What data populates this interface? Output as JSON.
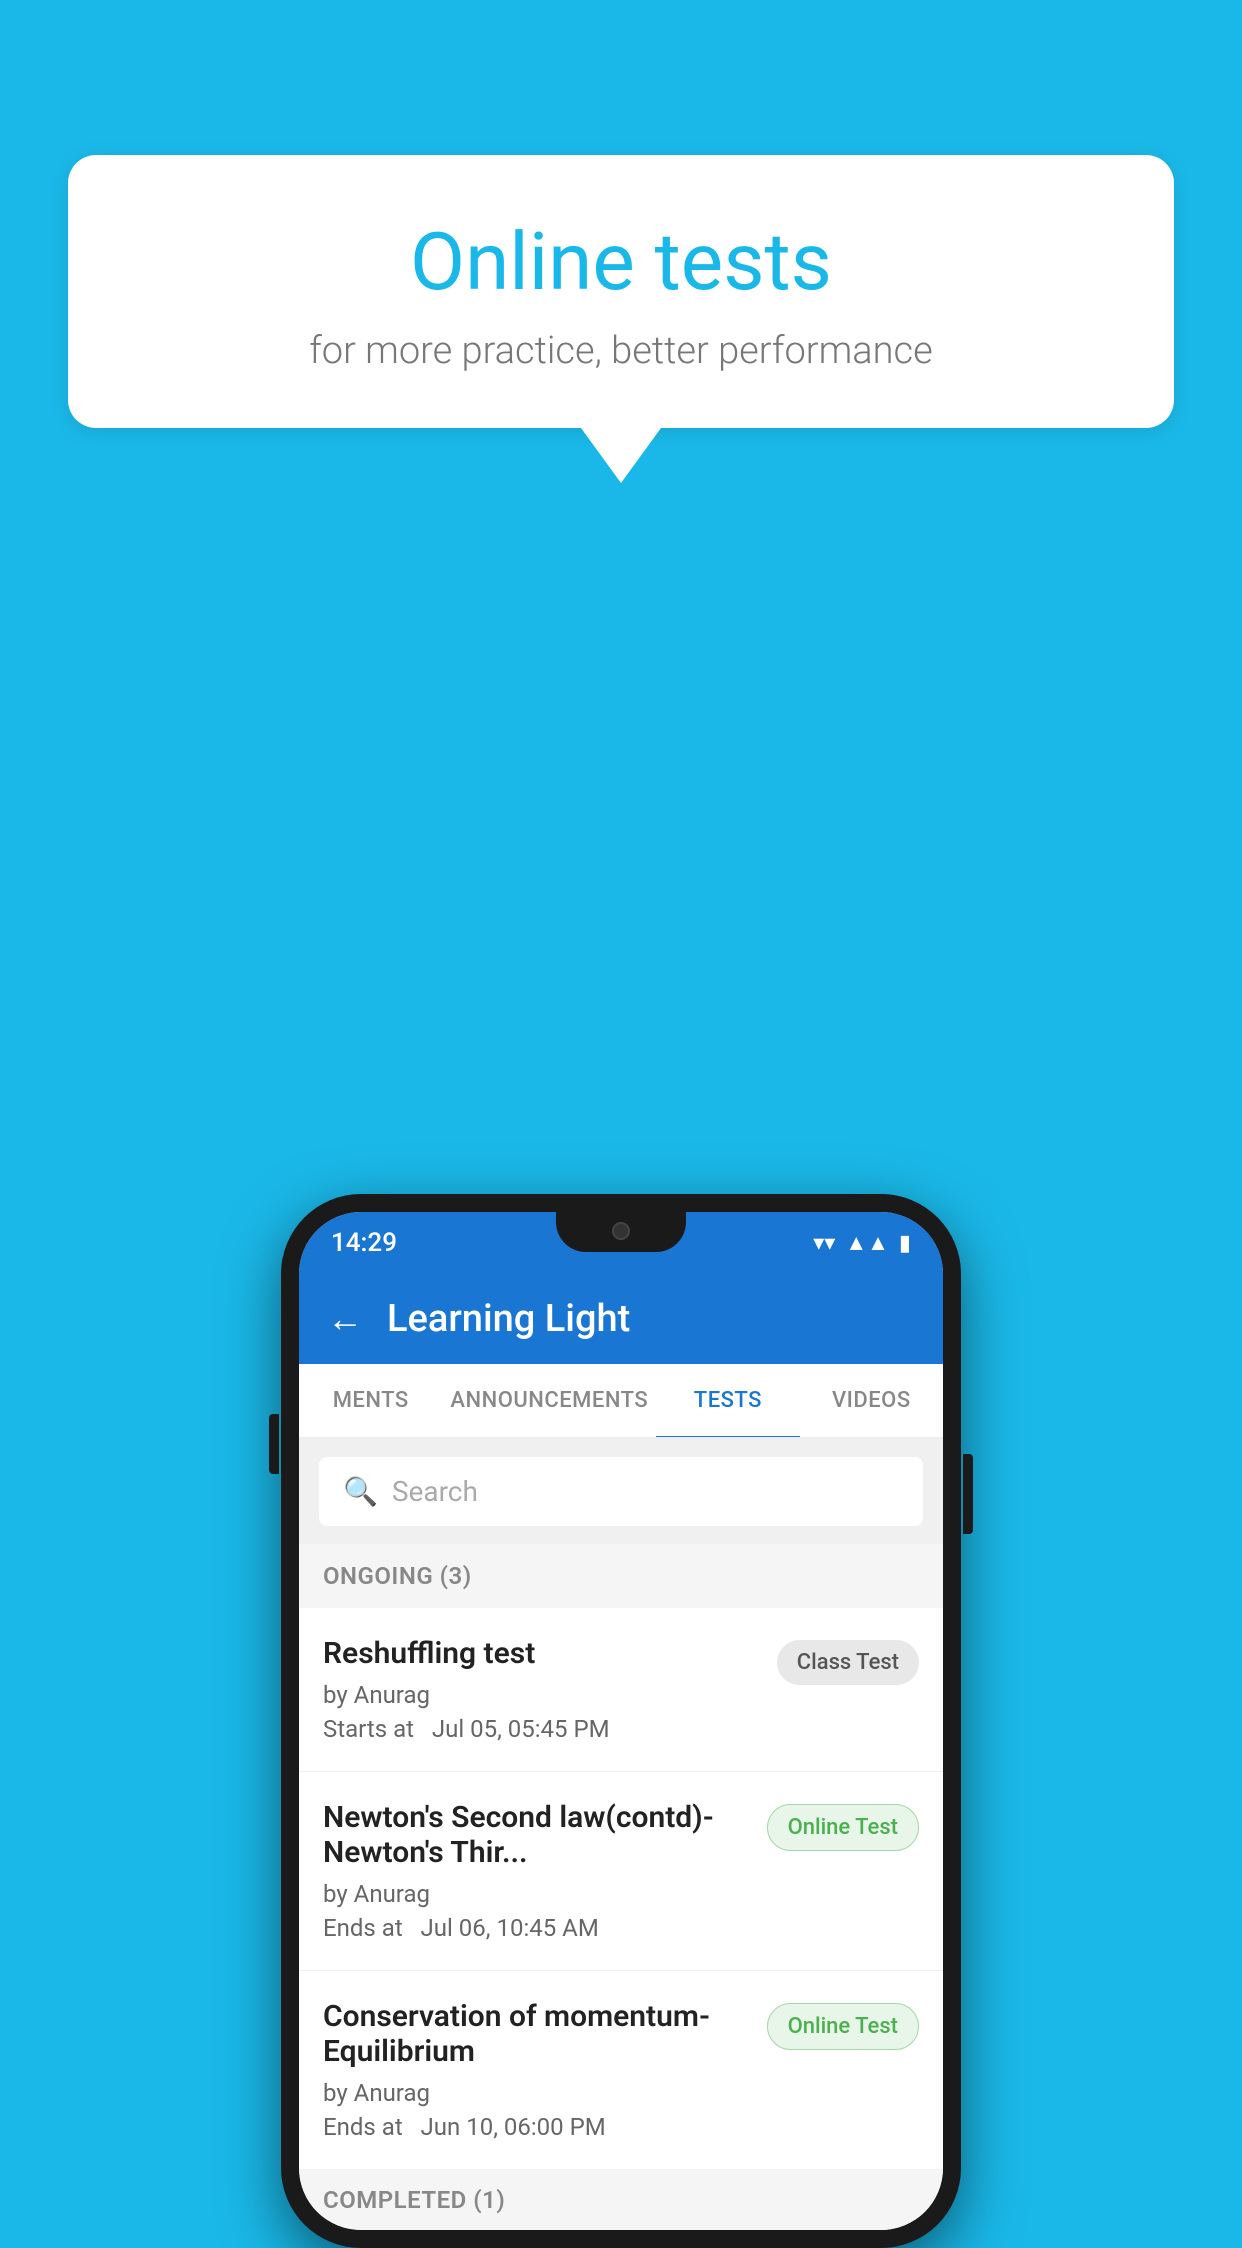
{
  "background_color": "#1ab8e8",
  "speech_bubble": {
    "title": "Online tests",
    "subtitle": "for more practice, better performance"
  },
  "status_bar": {
    "time": "14:29",
    "icons": [
      "wifi",
      "signal",
      "battery"
    ]
  },
  "app_bar": {
    "title": "Learning Light",
    "back_label": "←"
  },
  "tabs": [
    {
      "label": "MENTS",
      "active": false
    },
    {
      "label": "ANNOUNCEMENTS",
      "active": false
    },
    {
      "label": "TESTS",
      "active": true
    },
    {
      "label": "VIDEOS",
      "active": false
    }
  ],
  "search": {
    "placeholder": "Search"
  },
  "sections": [
    {
      "label": "ONGOING (3)",
      "tests": [
        {
          "title": "Reshuffling test",
          "by": "by Anurag",
          "time_label": "Starts at",
          "time": "Jul 05, 05:45 PM",
          "badge": "Class Test",
          "badge_type": "class"
        },
        {
          "title": "Newton's Second law(contd)-Newton's Thir...",
          "by": "by Anurag",
          "time_label": "Ends at",
          "time": "Jul 06, 10:45 AM",
          "badge": "Online Test",
          "badge_type": "online"
        },
        {
          "title": "Conservation of momentum-Equilibrium",
          "by": "by Anurag",
          "time_label": "Ends at",
          "time": "Jun 10, 06:00 PM",
          "badge": "Online Test",
          "badge_type": "online"
        }
      ]
    }
  ],
  "completed_label": "COMPLETED (1)"
}
